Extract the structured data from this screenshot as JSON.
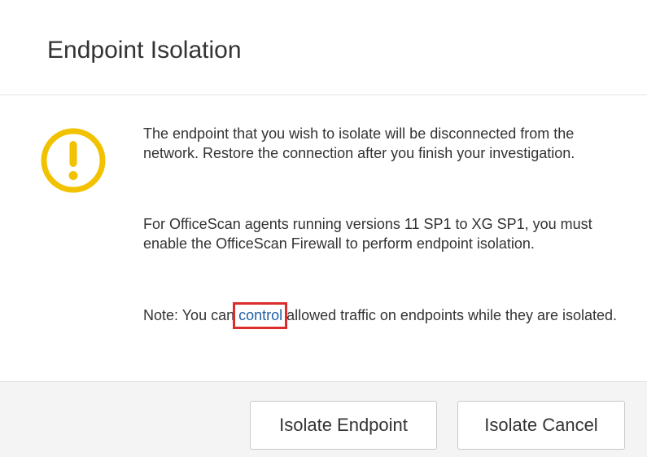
{
  "dialog": {
    "title": "Endpoint Isolation"
  },
  "icons": {
    "warning": "warning-circle-icon",
    "warning_color": "#f2c200"
  },
  "message": {
    "paragraph1": "The endpoint that you wish to isolate will be disconnected from the network. Restore the connection after you finish your investigation.",
    "paragraph2": "For OfficeScan agents running versions 11 SP1 to XG SP1, you must enable the OfficeScan Firewall to perform endpoint isolation.",
    "note_prefix": "Note: You can ",
    "note_link": "control",
    "note_suffix": " allowed traffic on endpoints while they are isolated."
  },
  "buttons": {
    "isolate": "Isolate Endpoint",
    "cancel": "Isolate Cancel"
  },
  "colors": {
    "link": "#1f5fa6",
    "highlight": "#dd2c2c",
    "footer_bg": "#f4f4f4"
  }
}
